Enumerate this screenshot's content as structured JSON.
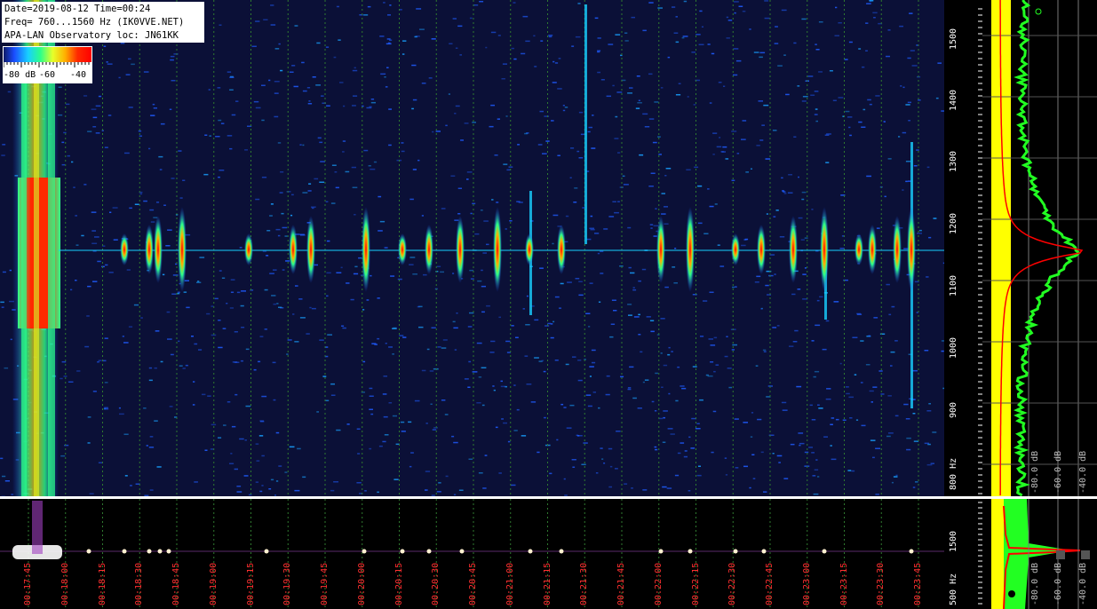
{
  "info": {
    "line1": "Date=2019-08-12 Time=00:24",
    "line2": "Freq= 760...1560 Hz (IK0VVE.NET)",
    "line3": "APA-LAN Observatory loc: JN61KK"
  },
  "scale": {
    "l1": "-80 dB",
    "l2": "-60",
    "l3": "-40"
  },
  "freq_labels": [
    "1500",
    "1400",
    "1300",
    "1200",
    "1100",
    "1000",
    "900",
    "800 Hz"
  ],
  "scope_freq_labels": [
    "1500",
    "500 Hz"
  ],
  "spec_labels": [
    "-80.0 dB",
    "-60.0 dB",
    "-40.0 dB"
  ],
  "spec2_labels": [
    "-80.0 dB",
    "-60.0 dB",
    "-40.0 dB"
  ],
  "time_labels": [
    "00:17:45",
    "00:18:00",
    "00:18:15",
    "00:18:30",
    "00:18:45",
    "00:19:00",
    "00:19:15",
    "00:19:30",
    "00:19:45",
    "00:20:00",
    "00:20:15",
    "00:20:30",
    "00:20:45",
    "00:21:00",
    "00:21:15",
    "00:21:30",
    "00:21:45",
    "00:22:00",
    "00:22:15",
    "00:22:30",
    "00:22:45",
    "00:23:00",
    "00:23:15",
    "00:23:30",
    "00:23:45"
  ],
  "colors": {
    "grid": "#2f7a2f",
    "time_label": "#ff3030",
    "bg": "#0b1037"
  }
}
